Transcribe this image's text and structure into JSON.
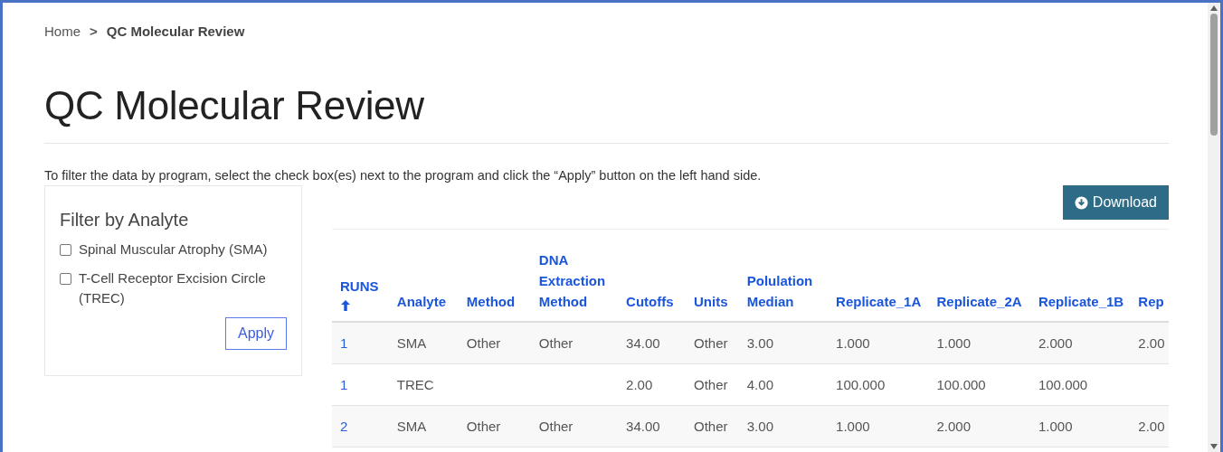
{
  "breadcrumb": [
    {
      "label": "Home",
      "current": false
    },
    {
      "label": "QC Molecular Review",
      "current": true
    }
  ],
  "breadcrumb_separator": ">",
  "title": "QC Molecular Review",
  "instructions": "To filter the data by program, select the check box(es) next to the program and click the “Apply” button on the left hand side.",
  "filter": {
    "title": "Filter by Analyte",
    "options": [
      {
        "label": "Spinal Muscular Atrophy (SMA)",
        "checked": false
      },
      {
        "label": "T-Cell Receptor Excision Circle (TREC)",
        "checked": false
      }
    ],
    "apply_button": "Apply"
  },
  "download_button": "Download",
  "table": {
    "columns": [
      {
        "label": "RUNS",
        "sorted": true
      },
      {
        "label": "Analyte",
        "sorted": false
      },
      {
        "label": "Method",
        "sorted": false
      },
      {
        "label": "DNA Extraction Method",
        "sorted": false
      },
      {
        "label": "Cutoffs",
        "sorted": false
      },
      {
        "label": "Units",
        "sorted": false
      },
      {
        "label": "Polulation Median",
        "sorted": false
      },
      {
        "label": "Replicate_1A",
        "sorted": false
      },
      {
        "label": "Replicate_2A",
        "sorted": false
      },
      {
        "label": "Replicate_1B",
        "sorted": false
      },
      {
        "label": "Rep",
        "sorted": false
      }
    ],
    "rows": [
      [
        "1",
        "SMA",
        "Other",
        "Other",
        "34.00",
        "Other",
        "3.00",
        "1.000",
        "1.000",
        "2.000",
        "2.00"
      ],
      [
        "1",
        "TREC",
        null,
        null,
        "2.00",
        "Other",
        "4.00",
        "100.000",
        "100.000",
        "100.000",
        null
      ],
      [
        "2",
        "SMA",
        "Other",
        "Other",
        "34.00",
        "Other",
        "3.00",
        "1.000",
        "2.000",
        "1.000",
        "2.00"
      ]
    ]
  }
}
